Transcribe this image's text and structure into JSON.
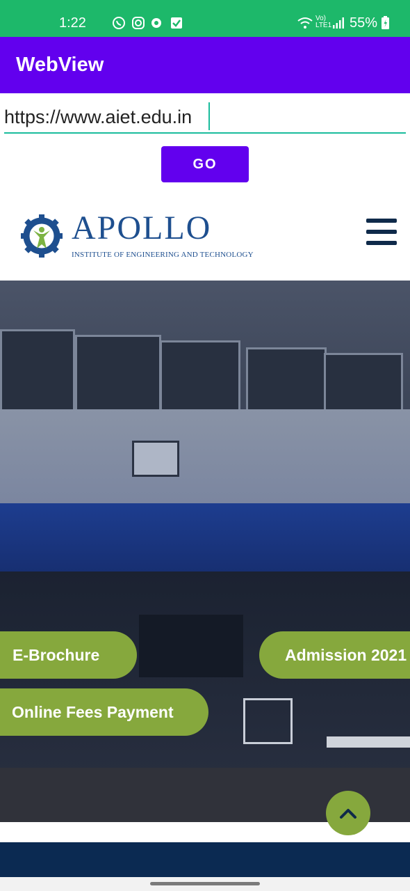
{
  "status_bar": {
    "time": "1:22",
    "battery": "55%",
    "network_label": "Vo) LTE1",
    "icons": [
      "whatsapp-icon",
      "instagram-icon",
      "chat-icon",
      "check-icon",
      "wifi-icon",
      "signal-icon",
      "battery-icon"
    ]
  },
  "app_bar": {
    "title": "WebView"
  },
  "url_bar": {
    "value": "https://www.aiet.edu.in"
  },
  "go_button": {
    "label": "GO"
  },
  "site": {
    "logo_title": "APOLLO",
    "logo_subtitle": "INSTITUTE OF ENGINEERING AND TECHNOLOGY",
    "buttons": {
      "ebrochure": "E-Brochure",
      "admission": "Admission 2021",
      "fees": "Online Fees Payment"
    }
  },
  "colors": {
    "status_bar": "#1db86a",
    "app_bar": "#6200ee",
    "accent_button": "#86a83d",
    "logo_blue": "#1e4f8f",
    "footer": "#0b2a52"
  }
}
